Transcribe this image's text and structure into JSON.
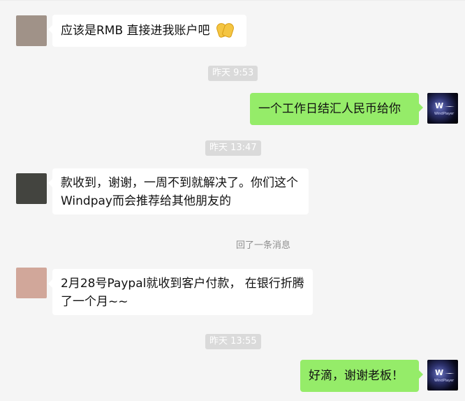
{
  "chat": {
    "messages": [
      {
        "side": "left",
        "avatar_color": "#a09288",
        "text": "应该是RMB 直接进我账户吧",
        "emoji": "folded-hands"
      },
      {
        "type": "timestamp",
        "text": "昨天 9:53"
      },
      {
        "side": "right",
        "avatar_label": "W",
        "avatar_caption": "WindPlayer",
        "text": "一个工作日结汇人民币给你"
      },
      {
        "type": "timestamp",
        "text": "昨天 13:47"
      },
      {
        "side": "left",
        "avatar_color": "#43443f",
        "text": "款收到，谢谢，一周不到就解决了。你们这个Windpay而会推荐给其他朋友的"
      },
      {
        "type": "system",
        "text": "回了一条消息"
      },
      {
        "side": "left",
        "avatar_color": "#d1a79a",
        "text": "2月28号Paypal就收到客户付款， 在银行折腾了一个月~~"
      },
      {
        "type": "timestamp",
        "text": "昨天 13:55"
      },
      {
        "side": "right",
        "avatar_label": "W",
        "avatar_caption": "WindPlayer",
        "text": "好滴，谢谢老板！"
      }
    ]
  },
  "colors": {
    "chat_bg": "#f5f5f5",
    "incoming_bubble": "#ffffff",
    "outgoing_bubble": "#95ec69",
    "timestamp_bg": "#dadada",
    "timestamp_text": "#ffffff",
    "system_text": "#8e8e8e",
    "message_text": "#111111"
  }
}
